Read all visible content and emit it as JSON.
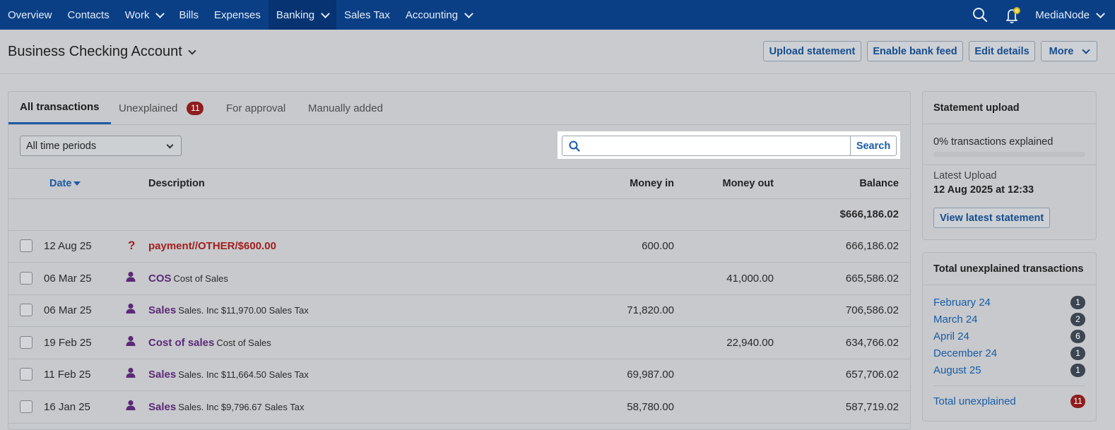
{
  "nav": {
    "items": [
      {
        "label": "Overview",
        "dropdown": false,
        "active": false
      },
      {
        "label": "Contacts",
        "dropdown": false,
        "active": false
      },
      {
        "label": "Work",
        "dropdown": true,
        "active": false
      },
      {
        "label": "Bills",
        "dropdown": false,
        "active": false
      },
      {
        "label": "Expenses",
        "dropdown": false,
        "active": false
      },
      {
        "label": "Banking",
        "dropdown": true,
        "active": true
      },
      {
        "label": "Sales Tax",
        "dropdown": false,
        "active": false
      },
      {
        "label": "Accounting",
        "dropdown": true,
        "active": false
      }
    ],
    "org_name": "MediaNode",
    "icons": [
      "search-icon",
      "bell-icon"
    ]
  },
  "header": {
    "account_title": "Business Checking Account",
    "buttons": {
      "upload": "Upload statement",
      "bank_feed": "Enable bank feed",
      "edit": "Edit details",
      "more": "More"
    }
  },
  "tabs": [
    {
      "label": "All transactions",
      "active": true
    },
    {
      "label": "Unexplained",
      "badge": "11"
    },
    {
      "label": "For approval"
    },
    {
      "label": "Manually added"
    }
  ],
  "filter": {
    "selected": "All time periods"
  },
  "search": {
    "value": "",
    "placeholder": "",
    "button": "Search"
  },
  "table": {
    "headers": {
      "date": "Date",
      "description": "Description",
      "money_in": "Money in",
      "money_out": "Money out",
      "balance": "Balance"
    },
    "opening_balance": "$666,186.02",
    "rows": [
      {
        "date": "12 Aug 25",
        "icon": "question-icon",
        "category": "payment//OTHER/$600.00",
        "detail": "",
        "money_in": "600.00",
        "money_out": "",
        "balance": "666,186.02",
        "unexplained": true
      },
      {
        "date": "06 Mar 25",
        "icon": "person-icon",
        "category": "COS",
        "detail": "Cost of Sales",
        "money_in": "",
        "money_out": "41,000.00",
        "balance": "665,586.02"
      },
      {
        "date": "06 Mar 25",
        "icon": "person-icon",
        "category": "Sales",
        "detail": "Sales. Inc $11,970.00 Sales Tax",
        "money_in": "71,820.00",
        "money_out": "",
        "balance": "706,586.02"
      },
      {
        "date": "19 Feb 25",
        "icon": "person-icon",
        "category": "Cost of sales",
        "detail": "Cost of Sales",
        "money_in": "",
        "money_out": "22,940.00",
        "balance": "634,766.02"
      },
      {
        "date": "11 Feb 25",
        "icon": "person-icon",
        "category": "Sales",
        "detail": "Sales. Inc $11,664.50 Sales Tax",
        "money_in": "69,987.00",
        "money_out": "",
        "balance": "657,706.02"
      },
      {
        "date": "16 Jan 25",
        "icon": "person-icon",
        "category": "Sales",
        "detail": "Sales. Inc $9,796.67 Sales Tax",
        "money_in": "58,780.00",
        "money_out": "",
        "balance": "587,719.02"
      }
    ]
  },
  "statement_upload": {
    "title": "Statement upload",
    "explained_text": "0% transactions explained",
    "explained_fraction": 0,
    "latest_label": "Latest Upload",
    "latest_value": "12 Aug 2025 at 12:33",
    "button": "View latest statement"
  },
  "unexplained": {
    "title": "Total unexplained transactions",
    "months": [
      {
        "label": "February 24",
        "count": "1"
      },
      {
        "label": "March 24",
        "count": "2"
      },
      {
        "label": "April 24",
        "count": "6"
      },
      {
        "label": "December 24",
        "count": "1"
      },
      {
        "label": "August 25",
        "count": "1"
      }
    ],
    "total_label": "Total unexplained",
    "total_count": "11"
  },
  "colors": {
    "nav_bg": "#0a3f86",
    "accent": "#1d5aa3",
    "danger": "#8e1d1d",
    "category": "#5b2a78"
  }
}
